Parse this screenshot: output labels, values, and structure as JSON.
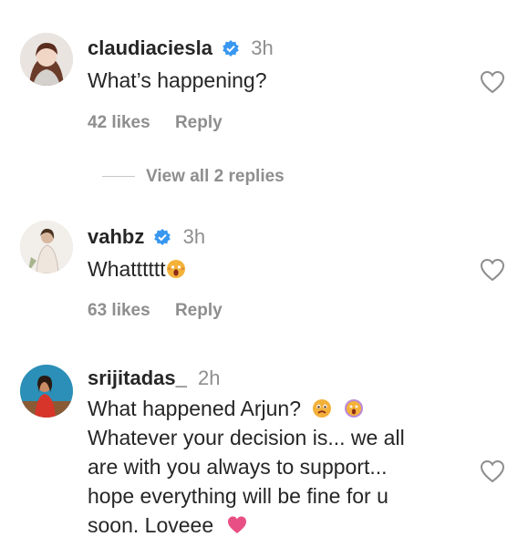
{
  "comments": [
    {
      "username": "claudiaciesla",
      "verified": true,
      "time": "3h",
      "text": "What’s happening?",
      "likes": "42 likes",
      "reply": "Reply"
    },
    {
      "username": "vahbz",
      "verified": true,
      "time": "3h",
      "text": "Whatttttt",
      "emoji": "face-screaming-emoji",
      "likes": "63 likes",
      "reply": "Reply"
    },
    {
      "username": "srijitadas_",
      "verified": false,
      "time": "2h",
      "text_line1": "What happened Arjun?",
      "text_line2": "Whatever your decision is... we all",
      "text_line3": "are with you always to support...",
      "text_line4": "hope everything will be fine for u",
      "text_line5": "soon. Loveee",
      "emojis": [
        "worried-face-emoji",
        "face-screaming-emoji",
        "heart-emoji"
      ]
    }
  ],
  "view_replies": "View all 2 replies",
  "colors": {
    "verified": "#3897f0",
    "muted": "#8e8e8e",
    "text": "#262626",
    "heart_emoji": "#e84f84"
  },
  "icons": {
    "like": "heart-outline-icon",
    "verified": "verified-badge-icon"
  }
}
